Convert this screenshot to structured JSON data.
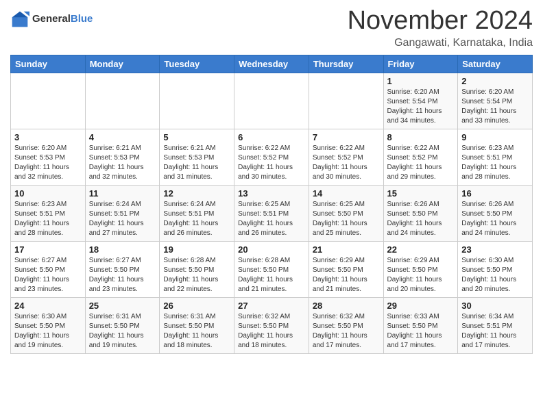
{
  "logo": {
    "general": "General",
    "blue": "Blue"
  },
  "title": "November 2024",
  "location": "Gangawati, Karnataka, India",
  "days_of_week": [
    "Sunday",
    "Monday",
    "Tuesday",
    "Wednesday",
    "Thursday",
    "Friday",
    "Saturday"
  ],
  "weeks": [
    [
      {
        "day": "",
        "info": ""
      },
      {
        "day": "",
        "info": ""
      },
      {
        "day": "",
        "info": ""
      },
      {
        "day": "",
        "info": ""
      },
      {
        "day": "",
        "info": ""
      },
      {
        "day": "1",
        "info": "Sunrise: 6:20 AM\nSunset: 5:54 PM\nDaylight: 11 hours\nand 34 minutes."
      },
      {
        "day": "2",
        "info": "Sunrise: 6:20 AM\nSunset: 5:54 PM\nDaylight: 11 hours\nand 33 minutes."
      }
    ],
    [
      {
        "day": "3",
        "info": "Sunrise: 6:20 AM\nSunset: 5:53 PM\nDaylight: 11 hours\nand 32 minutes."
      },
      {
        "day": "4",
        "info": "Sunrise: 6:21 AM\nSunset: 5:53 PM\nDaylight: 11 hours\nand 32 minutes."
      },
      {
        "day": "5",
        "info": "Sunrise: 6:21 AM\nSunset: 5:53 PM\nDaylight: 11 hours\nand 31 minutes."
      },
      {
        "day": "6",
        "info": "Sunrise: 6:22 AM\nSunset: 5:52 PM\nDaylight: 11 hours\nand 30 minutes."
      },
      {
        "day": "7",
        "info": "Sunrise: 6:22 AM\nSunset: 5:52 PM\nDaylight: 11 hours\nand 30 minutes."
      },
      {
        "day": "8",
        "info": "Sunrise: 6:22 AM\nSunset: 5:52 PM\nDaylight: 11 hours\nand 29 minutes."
      },
      {
        "day": "9",
        "info": "Sunrise: 6:23 AM\nSunset: 5:51 PM\nDaylight: 11 hours\nand 28 minutes."
      }
    ],
    [
      {
        "day": "10",
        "info": "Sunrise: 6:23 AM\nSunset: 5:51 PM\nDaylight: 11 hours\nand 28 minutes."
      },
      {
        "day": "11",
        "info": "Sunrise: 6:24 AM\nSunset: 5:51 PM\nDaylight: 11 hours\nand 27 minutes."
      },
      {
        "day": "12",
        "info": "Sunrise: 6:24 AM\nSunset: 5:51 PM\nDaylight: 11 hours\nand 26 minutes."
      },
      {
        "day": "13",
        "info": "Sunrise: 6:25 AM\nSunset: 5:51 PM\nDaylight: 11 hours\nand 26 minutes."
      },
      {
        "day": "14",
        "info": "Sunrise: 6:25 AM\nSunset: 5:50 PM\nDaylight: 11 hours\nand 25 minutes."
      },
      {
        "day": "15",
        "info": "Sunrise: 6:26 AM\nSunset: 5:50 PM\nDaylight: 11 hours\nand 24 minutes."
      },
      {
        "day": "16",
        "info": "Sunrise: 6:26 AM\nSunset: 5:50 PM\nDaylight: 11 hours\nand 24 minutes."
      }
    ],
    [
      {
        "day": "17",
        "info": "Sunrise: 6:27 AM\nSunset: 5:50 PM\nDaylight: 11 hours\nand 23 minutes."
      },
      {
        "day": "18",
        "info": "Sunrise: 6:27 AM\nSunset: 5:50 PM\nDaylight: 11 hours\nand 23 minutes."
      },
      {
        "day": "19",
        "info": "Sunrise: 6:28 AM\nSunset: 5:50 PM\nDaylight: 11 hours\nand 22 minutes."
      },
      {
        "day": "20",
        "info": "Sunrise: 6:28 AM\nSunset: 5:50 PM\nDaylight: 11 hours\nand 21 minutes."
      },
      {
        "day": "21",
        "info": "Sunrise: 6:29 AM\nSunset: 5:50 PM\nDaylight: 11 hours\nand 21 minutes."
      },
      {
        "day": "22",
        "info": "Sunrise: 6:29 AM\nSunset: 5:50 PM\nDaylight: 11 hours\nand 20 minutes."
      },
      {
        "day": "23",
        "info": "Sunrise: 6:30 AM\nSunset: 5:50 PM\nDaylight: 11 hours\nand 20 minutes."
      }
    ],
    [
      {
        "day": "24",
        "info": "Sunrise: 6:30 AM\nSunset: 5:50 PM\nDaylight: 11 hours\nand 19 minutes."
      },
      {
        "day": "25",
        "info": "Sunrise: 6:31 AM\nSunset: 5:50 PM\nDaylight: 11 hours\nand 19 minutes."
      },
      {
        "day": "26",
        "info": "Sunrise: 6:31 AM\nSunset: 5:50 PM\nDaylight: 11 hours\nand 18 minutes."
      },
      {
        "day": "27",
        "info": "Sunrise: 6:32 AM\nSunset: 5:50 PM\nDaylight: 11 hours\nand 18 minutes."
      },
      {
        "day": "28",
        "info": "Sunrise: 6:32 AM\nSunset: 5:50 PM\nDaylight: 11 hours\nand 17 minutes."
      },
      {
        "day": "29",
        "info": "Sunrise: 6:33 AM\nSunset: 5:50 PM\nDaylight: 11 hours\nand 17 minutes."
      },
      {
        "day": "30",
        "info": "Sunrise: 6:34 AM\nSunset: 5:51 PM\nDaylight: 11 hours\nand 17 minutes."
      }
    ]
  ]
}
